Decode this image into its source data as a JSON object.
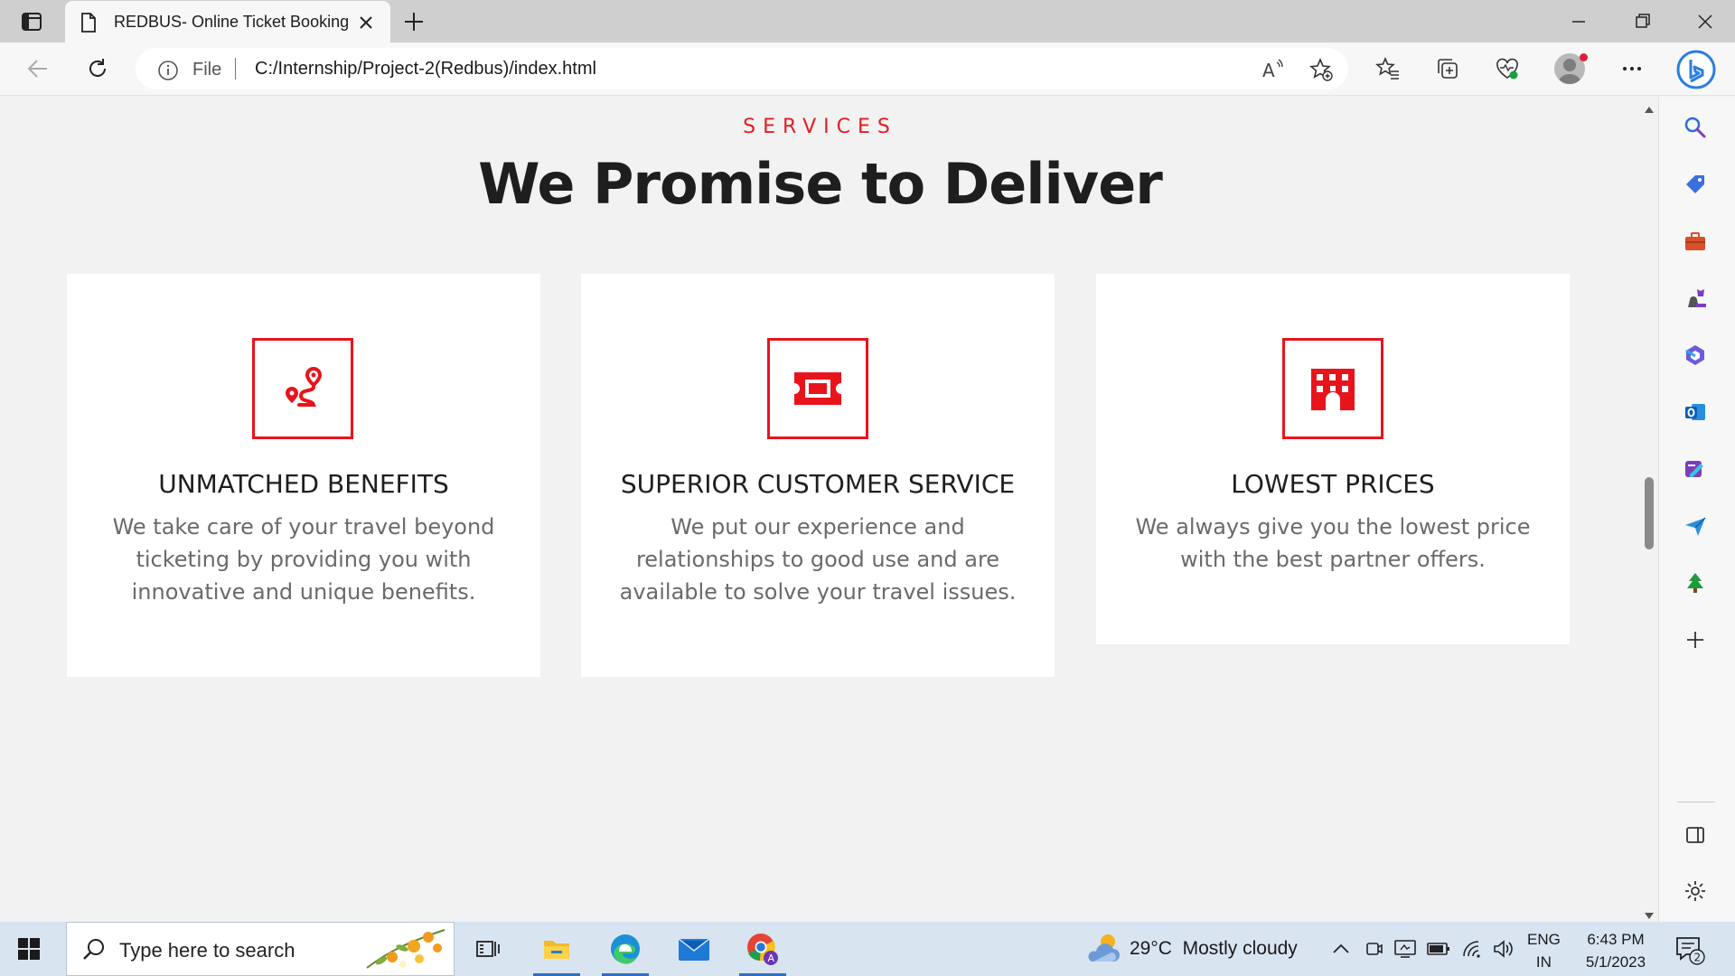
{
  "browser": {
    "tab_title": "REDBUS- Online Ticket Booking",
    "omnibox_scheme": "File",
    "omnibox_url": "C:/Internship/Project-2(Redbus)/index.html"
  },
  "page": {
    "eyebrow": "SERVICES",
    "heading": "We Promise to Deliver",
    "accent_color": "#e41c24",
    "cards": [
      {
        "icon": "route-icon",
        "title": "UNMATCHED BENEFITS",
        "description": "We take care of your travel beyond ticketing by providing you with innovative and unique benefits."
      },
      {
        "icon": "ticket-icon",
        "title": "SUPERIOR CUSTOMER SERVICE",
        "description": "We put our experience and relationships to good use and are available to solve your travel issues."
      },
      {
        "icon": "hotel-icon",
        "title": "LOWEST PRICES",
        "description": "We always give you the lowest price with the best partner offers."
      }
    ]
  },
  "taskbar": {
    "search_placeholder": "Type here to search",
    "weather_temp": "29°C",
    "weather_desc": "Mostly cloudy",
    "lang_line1": "ENG",
    "lang_line2": "IN",
    "time": "6:43 PM",
    "date": "5/1/2023",
    "notification_count": "2"
  }
}
